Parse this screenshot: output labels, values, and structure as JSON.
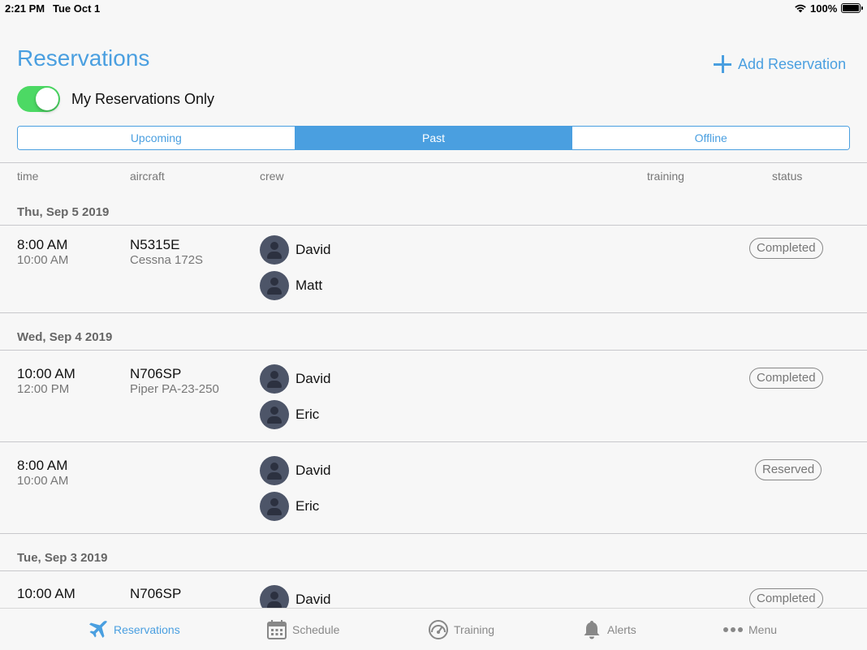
{
  "status_bar": {
    "time": "2:21 PM",
    "date": "Tue Oct 1",
    "battery": "100%"
  },
  "header": {
    "title": "Reservations",
    "add_label": "Add Reservation",
    "toggle_label": "My Reservations Only",
    "toggle_on": true
  },
  "segments": [
    {
      "label": "Upcoming",
      "active": false
    },
    {
      "label": "Past",
      "active": true
    },
    {
      "label": "Offline",
      "active": false
    }
  ],
  "columns": {
    "time": "time",
    "aircraft": "aircraft",
    "crew": "crew",
    "training": "training",
    "status": "status"
  },
  "days": [
    {
      "label": "Thu, Sep 5 2019",
      "rows": [
        {
          "start": "8:00 AM",
          "end": "10:00 AM",
          "tail": "N5315E",
          "model": "Cessna 172S",
          "crew": [
            "David",
            "Matt"
          ],
          "status": "Completed"
        }
      ]
    },
    {
      "label": "Wed, Sep 4 2019",
      "rows": [
        {
          "start": "10:00 AM",
          "end": "12:00 PM",
          "tail": "N706SP",
          "model": "Piper PA-23-250",
          "crew": [
            "David",
            "Eric"
          ],
          "status": "Completed"
        },
        {
          "start": "8:00 AM",
          "end": "10:00 AM",
          "tail": "",
          "model": "",
          "crew": [
            "David",
            "Eric"
          ],
          "status": "Reserved"
        }
      ]
    },
    {
      "label": "Tue, Sep 3 2019",
      "rows": [
        {
          "start": "10:00 AM",
          "end": "",
          "tail": "N706SP",
          "model": "",
          "crew": [
            "David"
          ],
          "status": "Completed"
        }
      ]
    }
  ],
  "tabs": [
    {
      "label": "Reservations",
      "icon": "airplane-icon",
      "active": true
    },
    {
      "label": "Schedule",
      "icon": "calendar-icon",
      "active": false
    },
    {
      "label": "Training",
      "icon": "gauge-icon",
      "active": false
    },
    {
      "label": "Alerts",
      "icon": "bell-icon",
      "active": false
    },
    {
      "label": "Menu",
      "icon": "more-dots-icon",
      "active": false
    }
  ],
  "colors": {
    "accent": "#4a9fe0",
    "toggle": "#4cd964",
    "avatar": "#4d5568"
  }
}
